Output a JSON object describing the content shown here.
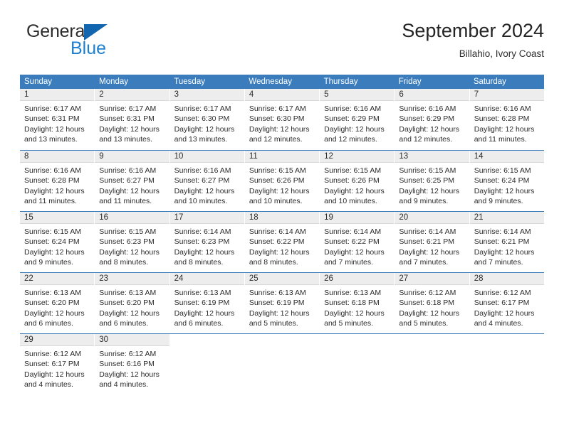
{
  "brand": {
    "name_top": "General",
    "name_bottom": "Blue",
    "accent_color": "#1c7fd0",
    "triangle_color": "#1266b0"
  },
  "header": {
    "title": "September 2024",
    "subtitle": "Billahio, Ivory Coast"
  },
  "calendar": {
    "header_bg": "#3b7cbd",
    "daynum_bg": "#ededed",
    "weekdays": [
      "Sunday",
      "Monday",
      "Tuesday",
      "Wednesday",
      "Thursday",
      "Friday",
      "Saturday"
    ],
    "weeks": [
      [
        {
          "day": "1",
          "sunrise": "Sunrise: 6:17 AM",
          "sunset": "Sunset: 6:31 PM",
          "daylight1": "Daylight: 12 hours",
          "daylight2": "and 13 minutes."
        },
        {
          "day": "2",
          "sunrise": "Sunrise: 6:17 AM",
          "sunset": "Sunset: 6:31 PM",
          "daylight1": "Daylight: 12 hours",
          "daylight2": "and 13 minutes."
        },
        {
          "day": "3",
          "sunrise": "Sunrise: 6:17 AM",
          "sunset": "Sunset: 6:30 PM",
          "daylight1": "Daylight: 12 hours",
          "daylight2": "and 13 minutes."
        },
        {
          "day": "4",
          "sunrise": "Sunrise: 6:17 AM",
          "sunset": "Sunset: 6:30 PM",
          "daylight1": "Daylight: 12 hours",
          "daylight2": "and 12 minutes."
        },
        {
          "day": "5",
          "sunrise": "Sunrise: 6:16 AM",
          "sunset": "Sunset: 6:29 PM",
          "daylight1": "Daylight: 12 hours",
          "daylight2": "and 12 minutes."
        },
        {
          "day": "6",
          "sunrise": "Sunrise: 6:16 AM",
          "sunset": "Sunset: 6:29 PM",
          "daylight1": "Daylight: 12 hours",
          "daylight2": "and 12 minutes."
        },
        {
          "day": "7",
          "sunrise": "Sunrise: 6:16 AM",
          "sunset": "Sunset: 6:28 PM",
          "daylight1": "Daylight: 12 hours",
          "daylight2": "and 11 minutes."
        }
      ],
      [
        {
          "day": "8",
          "sunrise": "Sunrise: 6:16 AM",
          "sunset": "Sunset: 6:28 PM",
          "daylight1": "Daylight: 12 hours",
          "daylight2": "and 11 minutes."
        },
        {
          "day": "9",
          "sunrise": "Sunrise: 6:16 AM",
          "sunset": "Sunset: 6:27 PM",
          "daylight1": "Daylight: 12 hours",
          "daylight2": "and 11 minutes."
        },
        {
          "day": "10",
          "sunrise": "Sunrise: 6:16 AM",
          "sunset": "Sunset: 6:27 PM",
          "daylight1": "Daylight: 12 hours",
          "daylight2": "and 10 minutes."
        },
        {
          "day": "11",
          "sunrise": "Sunrise: 6:15 AM",
          "sunset": "Sunset: 6:26 PM",
          "daylight1": "Daylight: 12 hours",
          "daylight2": "and 10 minutes."
        },
        {
          "day": "12",
          "sunrise": "Sunrise: 6:15 AM",
          "sunset": "Sunset: 6:26 PM",
          "daylight1": "Daylight: 12 hours",
          "daylight2": "and 10 minutes."
        },
        {
          "day": "13",
          "sunrise": "Sunrise: 6:15 AM",
          "sunset": "Sunset: 6:25 PM",
          "daylight1": "Daylight: 12 hours",
          "daylight2": "and 9 minutes."
        },
        {
          "day": "14",
          "sunrise": "Sunrise: 6:15 AM",
          "sunset": "Sunset: 6:24 PM",
          "daylight1": "Daylight: 12 hours",
          "daylight2": "and 9 minutes."
        }
      ],
      [
        {
          "day": "15",
          "sunrise": "Sunrise: 6:15 AM",
          "sunset": "Sunset: 6:24 PM",
          "daylight1": "Daylight: 12 hours",
          "daylight2": "and 9 minutes."
        },
        {
          "day": "16",
          "sunrise": "Sunrise: 6:15 AM",
          "sunset": "Sunset: 6:23 PM",
          "daylight1": "Daylight: 12 hours",
          "daylight2": "and 8 minutes."
        },
        {
          "day": "17",
          "sunrise": "Sunrise: 6:14 AM",
          "sunset": "Sunset: 6:23 PM",
          "daylight1": "Daylight: 12 hours",
          "daylight2": "and 8 minutes."
        },
        {
          "day": "18",
          "sunrise": "Sunrise: 6:14 AM",
          "sunset": "Sunset: 6:22 PM",
          "daylight1": "Daylight: 12 hours",
          "daylight2": "and 8 minutes."
        },
        {
          "day": "19",
          "sunrise": "Sunrise: 6:14 AM",
          "sunset": "Sunset: 6:22 PM",
          "daylight1": "Daylight: 12 hours",
          "daylight2": "and 7 minutes."
        },
        {
          "day": "20",
          "sunrise": "Sunrise: 6:14 AM",
          "sunset": "Sunset: 6:21 PM",
          "daylight1": "Daylight: 12 hours",
          "daylight2": "and 7 minutes."
        },
        {
          "day": "21",
          "sunrise": "Sunrise: 6:14 AM",
          "sunset": "Sunset: 6:21 PM",
          "daylight1": "Daylight: 12 hours",
          "daylight2": "and 7 minutes."
        }
      ],
      [
        {
          "day": "22",
          "sunrise": "Sunrise: 6:13 AM",
          "sunset": "Sunset: 6:20 PM",
          "daylight1": "Daylight: 12 hours",
          "daylight2": "and 6 minutes."
        },
        {
          "day": "23",
          "sunrise": "Sunrise: 6:13 AM",
          "sunset": "Sunset: 6:20 PM",
          "daylight1": "Daylight: 12 hours",
          "daylight2": "and 6 minutes."
        },
        {
          "day": "24",
          "sunrise": "Sunrise: 6:13 AM",
          "sunset": "Sunset: 6:19 PM",
          "daylight1": "Daylight: 12 hours",
          "daylight2": "and 6 minutes."
        },
        {
          "day": "25",
          "sunrise": "Sunrise: 6:13 AM",
          "sunset": "Sunset: 6:19 PM",
          "daylight1": "Daylight: 12 hours",
          "daylight2": "and 5 minutes."
        },
        {
          "day": "26",
          "sunrise": "Sunrise: 6:13 AM",
          "sunset": "Sunset: 6:18 PM",
          "daylight1": "Daylight: 12 hours",
          "daylight2": "and 5 minutes."
        },
        {
          "day": "27",
          "sunrise": "Sunrise: 6:12 AM",
          "sunset": "Sunset: 6:18 PM",
          "daylight1": "Daylight: 12 hours",
          "daylight2": "and 5 minutes."
        },
        {
          "day": "28",
          "sunrise": "Sunrise: 6:12 AM",
          "sunset": "Sunset: 6:17 PM",
          "daylight1": "Daylight: 12 hours",
          "daylight2": "and 4 minutes."
        }
      ],
      [
        {
          "day": "29",
          "sunrise": "Sunrise: 6:12 AM",
          "sunset": "Sunset: 6:17 PM",
          "daylight1": "Daylight: 12 hours",
          "daylight2": "and 4 minutes."
        },
        {
          "day": "30",
          "sunrise": "Sunrise: 6:12 AM",
          "sunset": "Sunset: 6:16 PM",
          "daylight1": "Daylight: 12 hours",
          "daylight2": "and 4 minutes."
        },
        {
          "day": "",
          "sunrise": "",
          "sunset": "",
          "daylight1": "",
          "daylight2": ""
        },
        {
          "day": "",
          "sunrise": "",
          "sunset": "",
          "daylight1": "",
          "daylight2": ""
        },
        {
          "day": "",
          "sunrise": "",
          "sunset": "",
          "daylight1": "",
          "daylight2": ""
        },
        {
          "day": "",
          "sunrise": "",
          "sunset": "",
          "daylight1": "",
          "daylight2": ""
        },
        {
          "day": "",
          "sunrise": "",
          "sunset": "",
          "daylight1": "",
          "daylight2": ""
        }
      ]
    ]
  }
}
